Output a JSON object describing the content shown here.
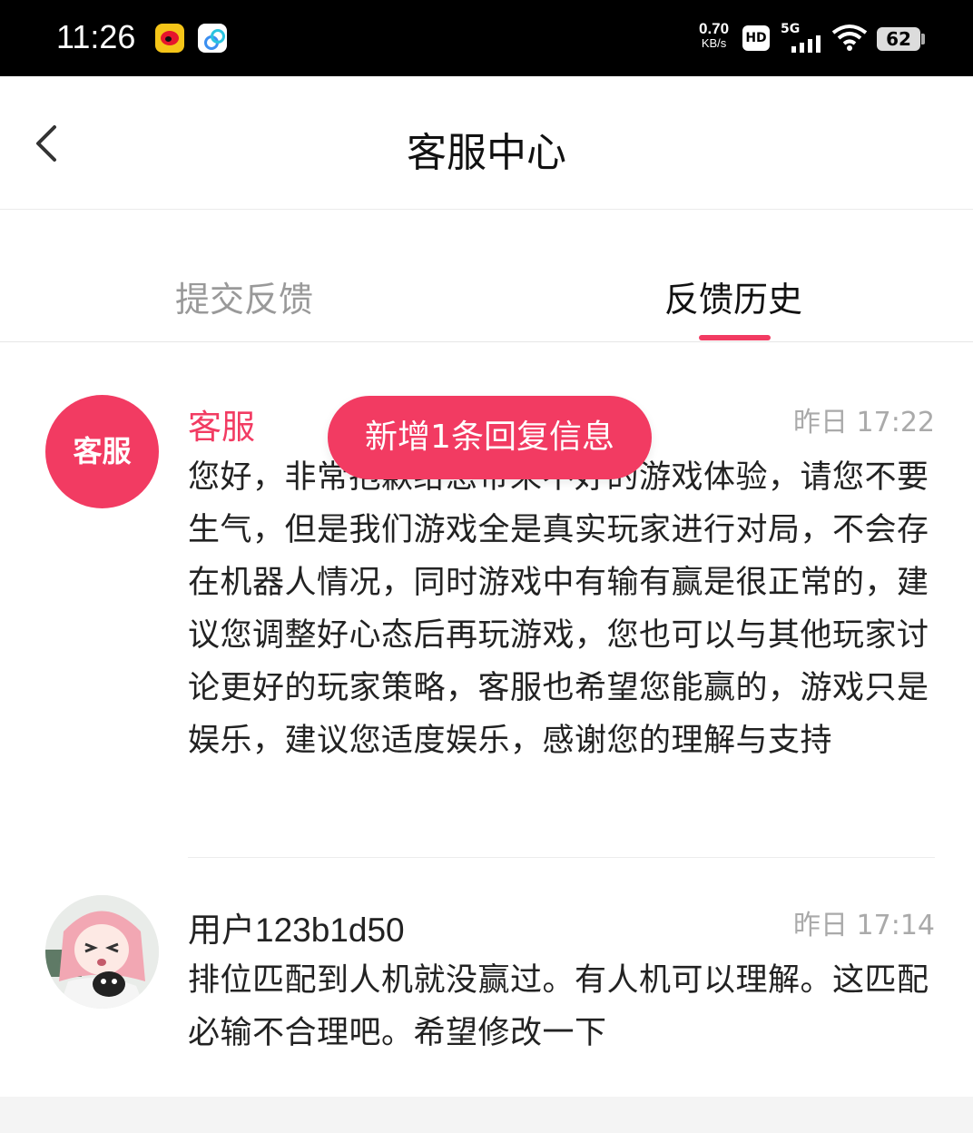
{
  "status_bar": {
    "time": "11:26",
    "net_speed_value": "0.70",
    "net_speed_unit": "KB/s",
    "hd_label": "HD",
    "network_label": "5G",
    "battery": "62"
  },
  "header": {
    "title": "客服中心"
  },
  "tabs": [
    {
      "label": "提交反馈",
      "active": false
    },
    {
      "label": "反馈历史",
      "active": true
    }
  ],
  "toast": "新增1条回复信息",
  "messages": [
    {
      "sender": "客服",
      "avatar_text": "客服",
      "time": "昨日 17:22",
      "body": "您好，非常抱歉给您带来不好的游戏体验，请您不要生气，但是我们游戏全是真实玩家进行对局，不会存在机器人情况，同时游戏中有输有赢是很正常的，建议您调整好心态后再玩游戏，您也可以与其他玩家讨论更好的玩家策略，客服也希望您能赢的，游戏只是娱乐，建议您适度娱乐，感谢您的理解与支持"
    },
    {
      "sender": "用户123b1d50",
      "time": "昨日 17:14",
      "body": "排位匹配到人机就没赢过。有人机可以理解。这匹配必输不合理吧。希望修改一下"
    }
  ],
  "colors": {
    "accent": "#f23b62",
    "muted": "#999999"
  }
}
